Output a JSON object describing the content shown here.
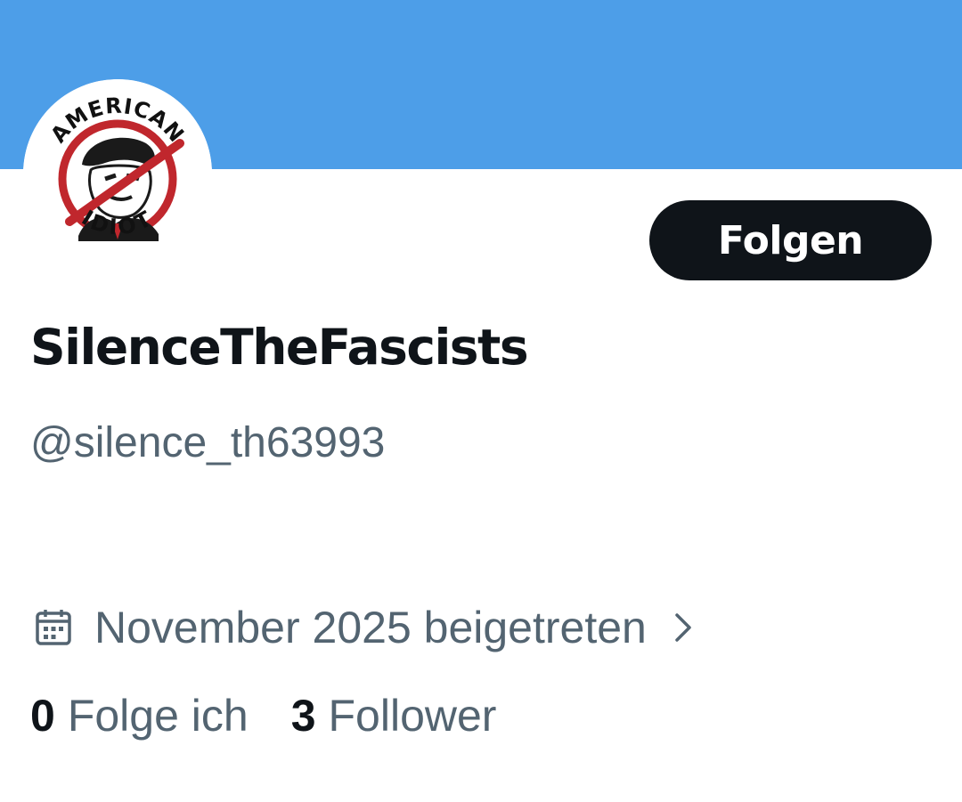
{
  "profile": {
    "avatar_logo_text_top": "AMERICAN",
    "avatar_logo_text_bottom": "IDIOT",
    "follow_label": "Folgen",
    "display_name": "SilenceTheFascists",
    "handle": "@silence_th63993",
    "joined_text": "November 2025 beigetreten",
    "following_count": "0",
    "following_label": "Folge ich",
    "followers_count": "3",
    "followers_label": "Follower"
  },
  "colors": {
    "banner": "#4d9ee8",
    "button_bg": "#0f1419",
    "secondary_text": "#536471",
    "primary_text": "#0f1419",
    "logo_red": "#c0272d"
  },
  "icons": {
    "joined": "calendar-icon",
    "joined_chevron": "chevron-right-icon"
  }
}
